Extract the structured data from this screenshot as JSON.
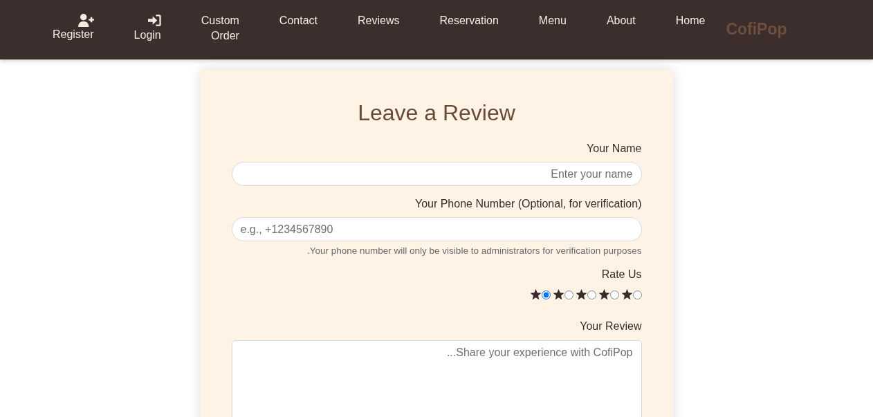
{
  "nav": {
    "items": [
      {
        "kind": "register",
        "label": "Register"
      },
      {
        "kind": "login",
        "label": "Login"
      },
      {
        "kind": "link",
        "label": "Custom Order"
      },
      {
        "kind": "link",
        "label": "Contact"
      },
      {
        "kind": "link",
        "label": "Reviews"
      },
      {
        "kind": "link",
        "label": "Reservation"
      },
      {
        "kind": "link",
        "label": "Menu"
      },
      {
        "kind": "link",
        "label": "About"
      },
      {
        "kind": "link",
        "label": "Home"
      }
    ],
    "logo": "CofiPop"
  },
  "form": {
    "title": "Leave a Review",
    "name": {
      "label": "Your Name",
      "placeholder": "Enter your name"
    },
    "phone": {
      "label": "Your Phone Number (Optional, for verification)",
      "placeholder": "e.g., +1234567890",
      "hint": ".Your phone number will only be visible to administrators for verification purposes"
    },
    "rating": {
      "label": "Rate Us",
      "options": [
        {
          "selected": true
        },
        {
          "selected": false
        },
        {
          "selected": false
        },
        {
          "selected": false
        },
        {
          "selected": false
        }
      ]
    },
    "review": {
      "label": "Your Review",
      "placeholder": "...Share your experience with CofiPop"
    }
  }
}
